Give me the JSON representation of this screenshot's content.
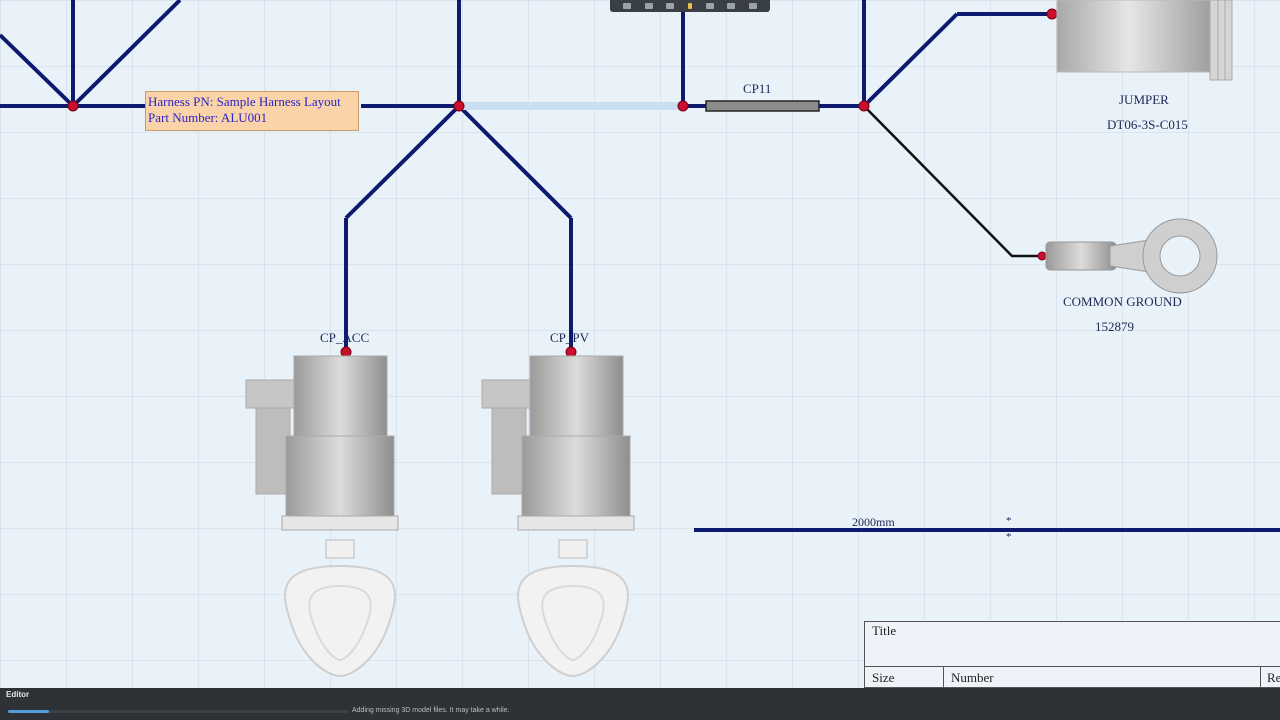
{
  "note": {
    "line1": "Harness PN: Sample Harness Layout",
    "line2": "Part Number: ALU001"
  },
  "labels": {
    "cp11": "CP11",
    "jumper_name": "JUMPER",
    "jumper_pn": "DT06-3S-C015",
    "ground_name": "COMMON GROUND",
    "ground_pn": "152879",
    "cp_acc": "CP_ACC",
    "cp_pv": "CP_PV",
    "dimension": "2000mm",
    "dim_marker": "*"
  },
  "title_block": {
    "title": "Title",
    "size": "Size",
    "number": "Number",
    "revision": "Re"
  },
  "status": {
    "panel": "Editor",
    "message": "Adding missing 3D model files. It may take a while.",
    "progress_fraction": 0.12
  },
  "colors": {
    "wire": "#0d1a6e",
    "wire_black": "#111111",
    "node": "#c8102e",
    "background": "#e9f1f9",
    "note_fill": "#fbd3a8",
    "note_text": "#2a25c8"
  }
}
